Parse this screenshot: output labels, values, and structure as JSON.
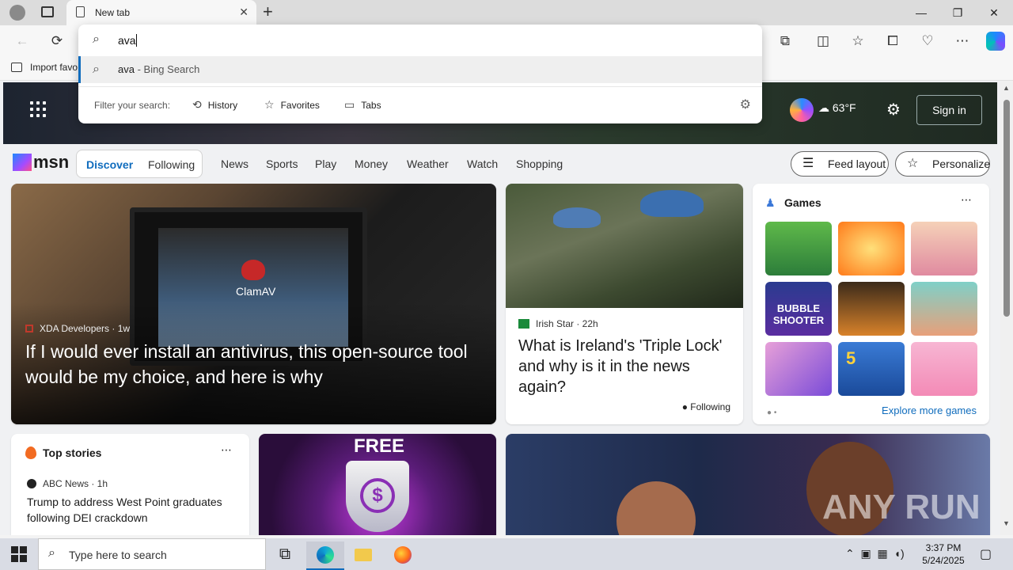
{
  "browser": {
    "tab_title": "New tab",
    "address_value": "ava",
    "favorites_bar_item": "Import favo"
  },
  "omnibox": {
    "suggestion_query": "ava",
    "suggestion_suffix": " - Bing Search",
    "filter_label": "Filter your search:",
    "filters": [
      "History",
      "Favorites",
      "Tabs"
    ]
  },
  "msn": {
    "weather_temp": "63°F",
    "sign_in": "Sign in",
    "logo": "msn",
    "tabs": [
      "Discover",
      "Following"
    ],
    "nav": [
      "News",
      "Sports",
      "Play",
      "Money",
      "Weather",
      "Watch",
      "Shopping"
    ],
    "feed_layout": "Feed layout",
    "personalize": "Personalize",
    "hero_card": {
      "source": "XDA Developers · 1w",
      "headline": "If I would ever install an antivirus, this open-source tool would be my choice, and here is why",
      "image_text": "ClamAV"
    },
    "irish_card": {
      "source": "Irish Star · 22h",
      "headline": "What is Ireland's 'Triple Lock' and why is it in the news again?",
      "following": "Following"
    },
    "games": {
      "title": "Games",
      "explore": "Explore more games",
      "tile_texts": [
        "BUBBLE SHOOTER",
        "5"
      ]
    },
    "top_stories": {
      "title": "Top stories",
      "source": "ABC News · 1h",
      "headline": "Trump to address West Point graduates following DEI crackdown"
    },
    "ad_card": {
      "text": "FREE"
    },
    "watermark": "ANY RUN"
  },
  "taskbar": {
    "search_placeholder": "Type here to search",
    "time": "3:37 PM",
    "date": "5/24/2025"
  }
}
